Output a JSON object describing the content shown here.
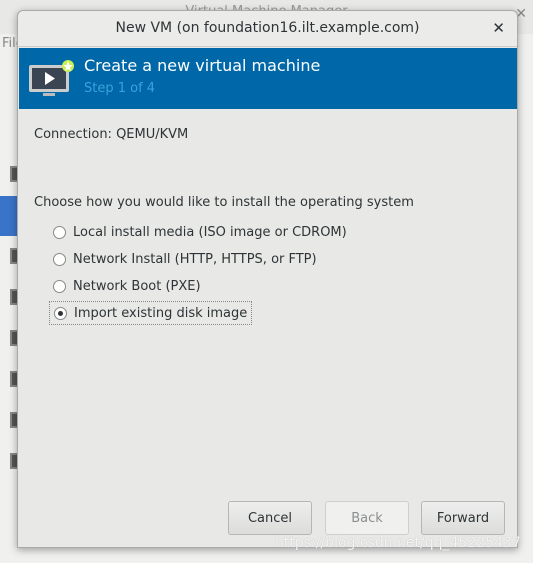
{
  "background_window": {
    "title": "Virtual Machine Manager",
    "menu_file": "File"
  },
  "dialog": {
    "title": "New VM (on foundation16.ilt.example.com)",
    "header": {
      "title": "Create a new virtual machine",
      "step": "Step 1 of 4"
    },
    "connection": "Connection:  QEMU/KVM",
    "prompt": "Choose how you would like to install the operating system",
    "options": [
      {
        "label": "Local install media (ISO image or CDROM)",
        "selected": false
      },
      {
        "label": "Network Install (HTTP, HTTPS, or FTP)",
        "selected": false
      },
      {
        "label": "Network Boot (PXE)",
        "selected": false
      },
      {
        "label": "Import existing disk image",
        "selected": true
      }
    ],
    "buttons": {
      "cancel": "Cancel",
      "back": "Back",
      "forward": "Forward"
    }
  },
  "watermark": "https://blog.csdn.net/qq_45225437",
  "colors": {
    "header": "#0067a8",
    "step": "#3aa2dc"
  }
}
